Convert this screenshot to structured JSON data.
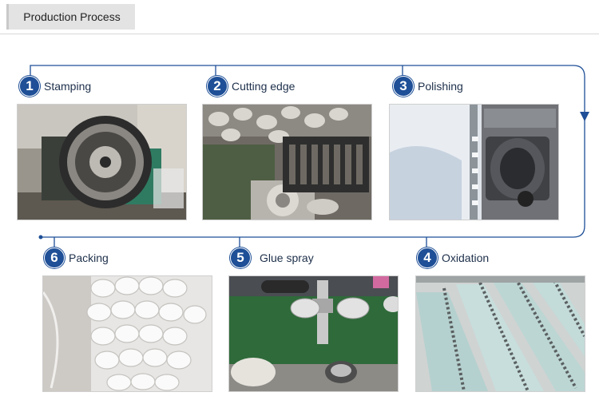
{
  "header": {
    "title": "Production Process"
  },
  "steps": [
    {
      "number": "1",
      "label": "Stamping"
    },
    {
      "number": "2",
      "label": "Cutting edge"
    },
    {
      "number": "3",
      "label": "Polishing"
    },
    {
      "number": "4",
      "label": "Oxidation"
    },
    {
      "number": "5",
      "label": "Glue spray"
    },
    {
      "number": "6",
      "label": "Packing"
    }
  ],
  "colors": {
    "accent": "#1e4f97",
    "flow_line": "#1e4f97"
  },
  "icons": {
    "flow_arrow": "arrow-down-icon"
  }
}
